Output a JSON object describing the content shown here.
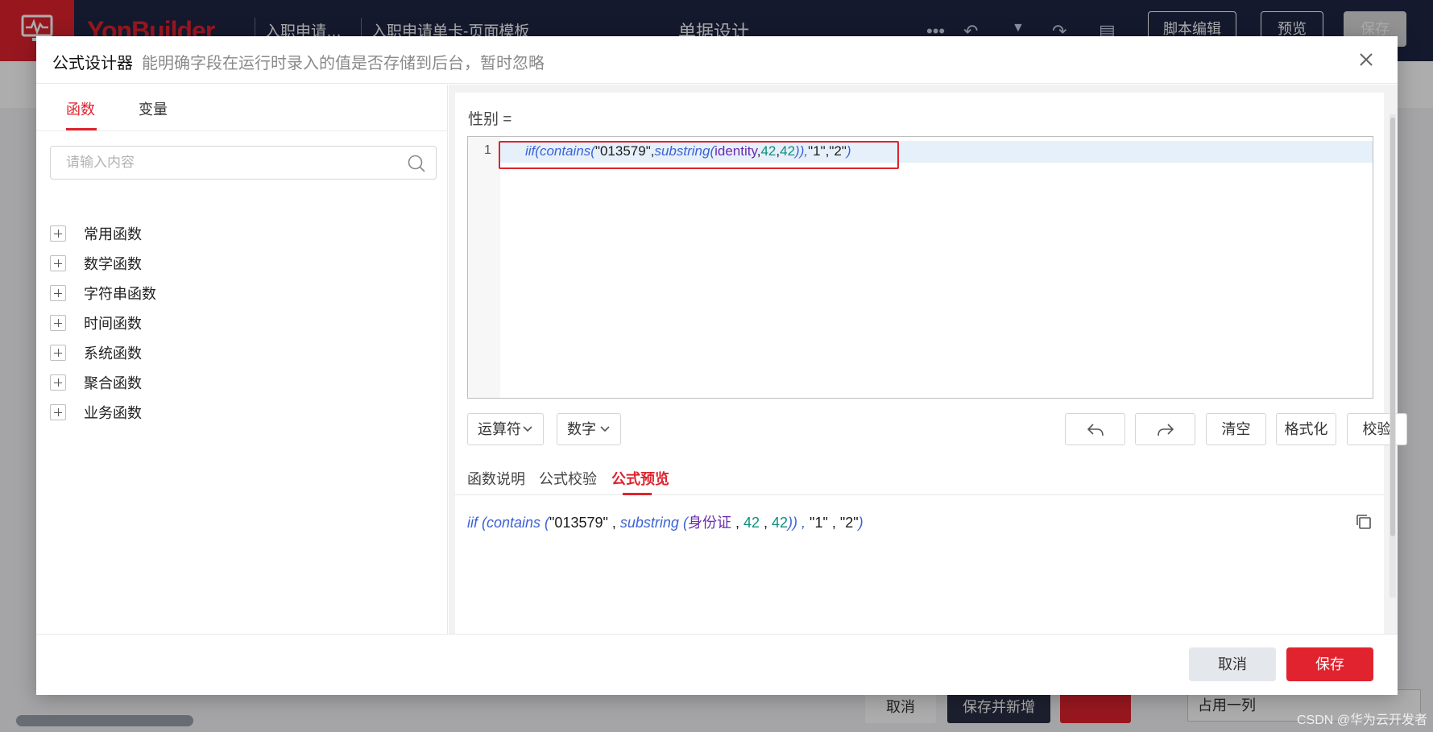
{
  "app": {
    "brand": "YonBuilder",
    "breadcrumbs": [
      "入职申请…",
      "入职申请单卡-页面模板"
    ],
    "center_title": "单据设计",
    "buttons": {
      "script_edit": "脚本编辑",
      "preview": "预览",
      "save": "保存"
    },
    "bottom": {
      "cancel": "取消",
      "save_and_new": "保存并新增",
      "select_value": "占用一列"
    },
    "watermark": "CSDN @华为云开发者社区"
  },
  "modal": {
    "title": "公式设计器",
    "subtitle": "能明确字段在运行时录入的值是否存储到后台，暂时忽略",
    "left_tabs": [
      "函数",
      "变量"
    ],
    "search_placeholder": "请输入内容",
    "function_groups": [
      "常用函数",
      "数学函数",
      "字符串函数",
      "时间函数",
      "系统函数",
      "聚合函数",
      "业务函数"
    ],
    "field_label": "性别 =",
    "editor": {
      "line_number": "1",
      "code": {
        "fn_iif": "iif(",
        "fn_contains": "contains(",
        "str_digits": "\"013579\"",
        "comma1": ",",
        "fn_substring": "substring(",
        "var": "identity",
        "comma2": ",",
        "num1": "42",
        "comma3": ",",
        "num2": "42",
        "close": ")),",
        "str_a": "\"1\"",
        "comma4": ",",
        "str_b": "\"2\"",
        "close2": ")"
      }
    },
    "toolbar": {
      "operator": "运算符",
      "number": "数字",
      "clear": "清空",
      "format": "格式化",
      "validate": "校验"
    },
    "info_tabs": [
      "函数说明",
      "公式校验",
      "公式预览"
    ],
    "preview": {
      "fn_iif": "iif (",
      "fn_contains": "contains (",
      "str_digits": "\"013579\"",
      "sep1": " , ",
      "fn_substring": "substring (",
      "var": "身份证",
      "sep2": " , ",
      "num1": "42",
      "sep3": " , ",
      "num2": "42",
      "close": ")) ,",
      "str_a": " \"1\"",
      "sep4": " , ",
      "str_b": "\"2\"",
      "close2": ")"
    },
    "footer": {
      "cancel": "取消",
      "save": "保存"
    }
  }
}
